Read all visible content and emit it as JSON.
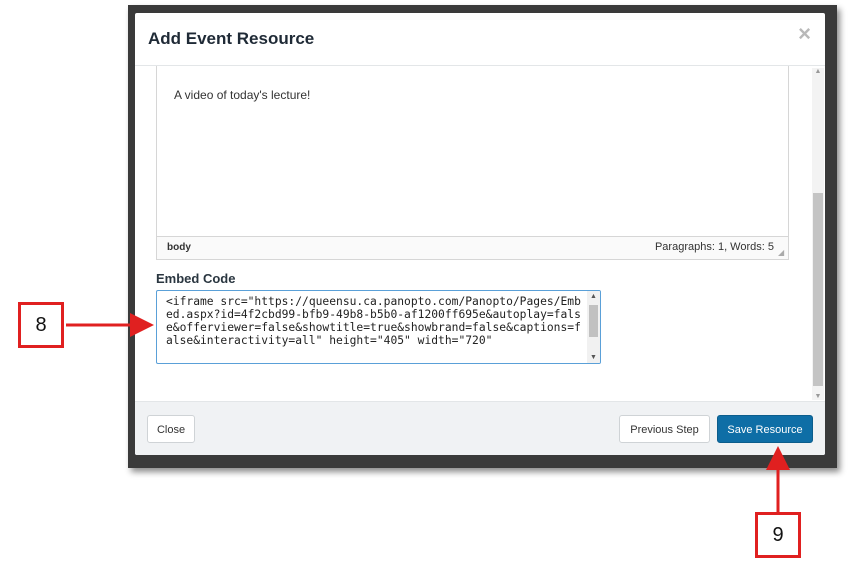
{
  "modal": {
    "title": "Add Event Resource",
    "close_glyph": "×",
    "editor": {
      "content": "A video of today's lecture!",
      "status_path": "body",
      "status_count": "Paragraphs: 1, Words: 5"
    },
    "embed": {
      "label": "Embed Code",
      "value": "<iframe src=\"https://queensu.ca.panopto.com/Panopto/Pages/Embed.aspx?id=4f2cbd99-bfb9-49b8-b5b0-af1200ff695e&autoplay=false&offerviewer=false&showtitle=true&showbrand=false&captions=false&interactivity=all\" height=\"405\" width=\"720\""
    },
    "footer": {
      "close_label": "Close",
      "previous_label": "Previous Step",
      "save_label": "Save Resource"
    }
  },
  "annotations": {
    "callout_8": "8",
    "callout_9": "9",
    "arrow_color": "#e02020"
  },
  "colors": {
    "primary_button": "#0e6ea6",
    "backdrop": "#3a3a3a"
  }
}
